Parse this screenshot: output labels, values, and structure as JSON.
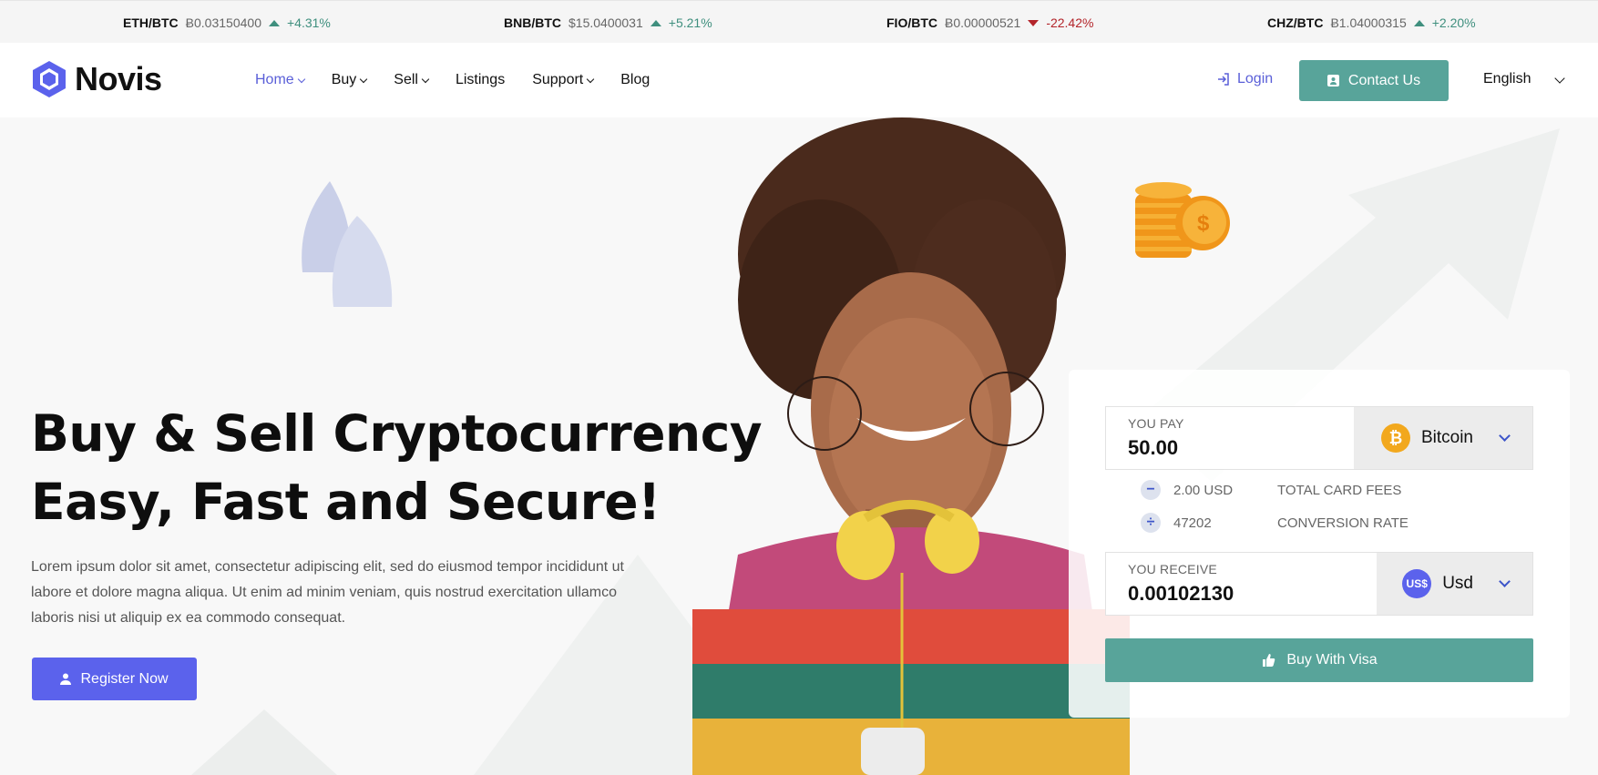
{
  "ticker": [
    {
      "pair": "ETH/BTC",
      "price": "Ƀ0.03150400",
      "change": "+4.31%",
      "direction": "up"
    },
    {
      "pair": "BNB/BTC",
      "price": "$15.0400031",
      "change": "+5.21%",
      "direction": "up"
    },
    {
      "pair": "FIO/BTC",
      "price": "Ƀ0.00000521",
      "change": "-22.42%",
      "direction": "down"
    },
    {
      "pair": "CHZ/BTC",
      "price": "Ƀ1.04000315",
      "change": "+2.20%",
      "direction": "up"
    }
  ],
  "header": {
    "logo_text": "Novis",
    "nav": [
      "Home",
      "Buy",
      "Sell",
      "Listings",
      "Support",
      "Blog"
    ],
    "login": "Login",
    "contact": "Contact Us",
    "language": "English"
  },
  "hero": {
    "headline_line1": "Buy & Sell Cryptocurrency",
    "headline_line2": "Easy, Fast and Secure!",
    "lead": "Lorem ipsum dolor sit amet, consectetur adipiscing elit, sed do eiusmod tempor incididunt ut labore et dolore magna aliqua. Ut enim ad minim veniam, quis nostrud exercitation ullamco laboris nisi ut aliquip ex ea commodo consequat.",
    "register": "Register Now"
  },
  "exchange": {
    "pay_label": "YOU PAY",
    "pay_value": "50.00",
    "pay_currency": "Bitcoin",
    "fee_amount": "2.00 USD",
    "fee_label": "TOTAL CARD FEES",
    "rate_amount": "47202",
    "rate_label": "CONVERSION RATE",
    "receive_label": "YOU RECEIVE",
    "receive_value": "0.00102130",
    "receive_currency": "Usd",
    "usd_badge": "US$",
    "btc_badge": "₿",
    "buy_button": "Buy With Visa"
  },
  "colors": {
    "brand": "#5b62ec",
    "teal": "#58a49a",
    "up": "#3f8f7e",
    "down": "#b3242a"
  }
}
